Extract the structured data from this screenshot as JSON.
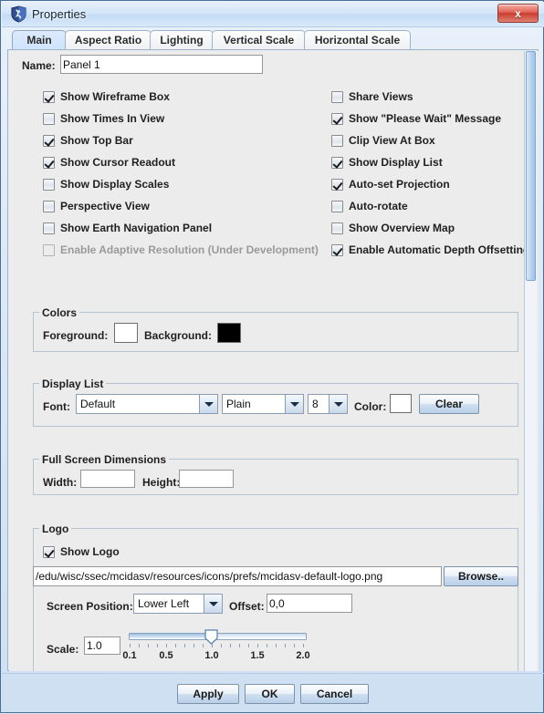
{
  "window": {
    "title": "Properties",
    "icon": "mcidasv-logo-icon",
    "close_label": "x"
  },
  "tabs": [
    {
      "label": "Main",
      "selected": true
    },
    {
      "label": "Aspect Ratio",
      "selected": false
    },
    {
      "label": "Lighting",
      "selected": false
    },
    {
      "label": "Vertical Scale",
      "selected": false
    },
    {
      "label": "Horizontal Scale",
      "selected": false
    }
  ],
  "name_field": {
    "label": "Name:",
    "value": "Panel 1",
    "placeholder": ""
  },
  "checkboxes_left": [
    {
      "label": "Show Wireframe Box",
      "checked": true,
      "enabled": true
    },
    {
      "label": "Show Times In View",
      "checked": false,
      "enabled": true
    },
    {
      "label": "Show Top Bar",
      "checked": true,
      "enabled": true
    },
    {
      "label": "Show Cursor Readout",
      "checked": true,
      "enabled": true
    },
    {
      "label": "Show Display Scales",
      "checked": false,
      "enabled": true
    },
    {
      "label": "Perspective View",
      "checked": false,
      "enabled": true
    },
    {
      "label": "Show Earth Navigation Panel",
      "checked": false,
      "enabled": true
    },
    {
      "label": "Enable Adaptive Resolution (Under Development)",
      "checked": false,
      "enabled": false
    }
  ],
  "checkboxes_right": [
    {
      "label": "Share Views",
      "checked": false,
      "enabled": true
    },
    {
      "label": "Show \"Please Wait\" Message",
      "checked": true,
      "enabled": true
    },
    {
      "label": "Clip View At Box",
      "checked": false,
      "enabled": true
    },
    {
      "label": "Show Display List",
      "checked": true,
      "enabled": true
    },
    {
      "label": "Auto-set Projection",
      "checked": true,
      "enabled": true
    },
    {
      "label": "Auto-rotate",
      "checked": false,
      "enabled": true
    },
    {
      "label": "Show Overview Map",
      "checked": false,
      "enabled": true
    },
    {
      "label": "Enable Automatic Depth Offsetting",
      "checked": true,
      "enabled": true
    }
  ],
  "colors_group": {
    "title": "Colors",
    "foreground_label": "Foreground:",
    "foreground_color": "#ffffff",
    "background_label": "Background:",
    "background_color": "#000000"
  },
  "display_list_group": {
    "title": "Display List",
    "font_label": "Font:",
    "font_family": "Default",
    "font_style": "Plain",
    "font_size": "8",
    "color_label": "Color:",
    "color_value": "#ffffff",
    "clear_label": "Clear"
  },
  "fullscreen_group": {
    "title": "Full Screen Dimensions",
    "width_label": "Width:",
    "width_value": "",
    "height_label": "Height:",
    "height_value": ""
  },
  "logo_group": {
    "title": "Logo",
    "show_logo_label": "Show Logo",
    "show_logo_checked": true,
    "path_value": "/edu/wisc/ssec/mcidasv/resources/icons/prefs/mcidasv-default-logo.png",
    "browse_label": "Browse..",
    "screen_position_label": "Screen Position:",
    "screen_position_value": "Lower Left",
    "offset_label": "Offset:",
    "offset_value": "0,0",
    "scale_label": "Scale:",
    "scale_value": "1.0",
    "slider": {
      "min": 0.1,
      "max": 2.0,
      "value": 1.0,
      "tick_labels": [
        "0.1",
        "0.5",
        "1.0",
        "1.5",
        "2.0"
      ],
      "minor_tick_count": 20
    }
  },
  "footer_buttons": [
    {
      "label": "Apply"
    },
    {
      "label": "OK"
    },
    {
      "label": "Cancel"
    }
  ],
  "theme": {
    "panel_bg": "#ececec",
    "accent": "#4a6f95",
    "selected_tab_bg": "#d4e6fb",
    "disabled_text": "#9a9a9a"
  }
}
